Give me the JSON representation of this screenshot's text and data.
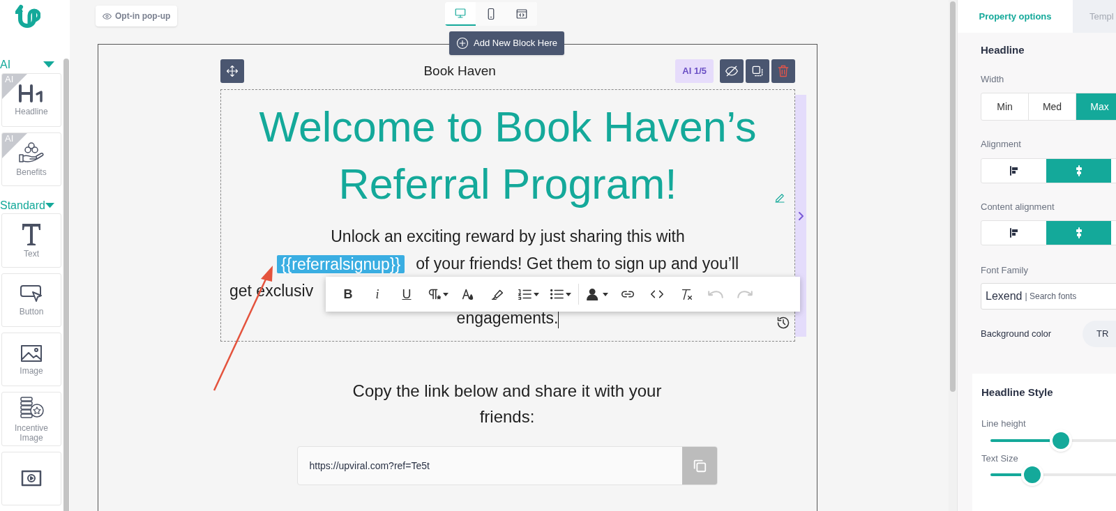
{
  "sidebar": {
    "sections": [
      {
        "title": "AI",
        "items": [
          {
            "label": "Headline",
            "kind": "h1",
            "badge": "AI"
          },
          {
            "label": "Benefits",
            "kind": "benefits",
            "badge": "AI"
          }
        ]
      },
      {
        "title": "Standard",
        "items": [
          {
            "label": "Text",
            "kind": "text"
          },
          {
            "label": "Button",
            "kind": "button"
          },
          {
            "label": "Image",
            "kind": "image"
          },
          {
            "label": "Incentive Image",
            "kind": "incentive"
          },
          {
            "kind": "video"
          }
        ]
      }
    ]
  },
  "topbar": {
    "preview_button": "Opt-in pop-up",
    "devices": [
      {
        "kind": "desktop",
        "selected": true
      },
      {
        "kind": "mobile",
        "selected": false
      },
      {
        "kind": "code",
        "selected": false
      }
    ],
    "add_block": "Add New Block Here"
  },
  "block": {
    "title": "Book Haven",
    "ai_counter": "AI 1/5",
    "headline": "Welcome to Book Haven’s Referral Program!",
    "paragraph_lines": [
      {
        "kind": "line",
        "parts": [
          {
            "kind": "text",
            "text": "Unlock an exciting reward by just sharing this with"
          }
        ]
      },
      {
        "kind": "line",
        "parts": [
          {
            "kind": "token",
            "text": "{{referralsignup}}"
          },
          {
            "kind": "text",
            "text": "of your friends! Get them to sign up and you’ll"
          }
        ]
      },
      {
        "kind": "covered",
        "parts": [
          {
            "kind": "text",
            "text": "get exclusiv"
          }
        ]
      },
      {
        "kind": "line",
        "parts": [
          {
            "kind": "text",
            "text": "engagements."
          }
        ],
        "cursor": true
      }
    ],
    "format_toolbar": [
      {
        "kind": "bold",
        "label": "B",
        "disabled": false
      },
      {
        "kind": "italic",
        "label": "i",
        "disabled": false
      },
      {
        "kind": "underline",
        "label": "U",
        "disabled": false
      },
      {
        "kind": "paragraph",
        "disabled": false
      },
      {
        "kind": "color",
        "disabled": false
      },
      {
        "kind": "highlight",
        "disabled": false
      },
      {
        "kind": "ordered",
        "disabled": false
      },
      {
        "kind": "bullets",
        "disabled": false
      },
      {
        "kind": "person",
        "disabled": false
      },
      {
        "kind": "link",
        "disabled": false
      },
      {
        "kind": "code",
        "disabled": false
      },
      {
        "kind": "clear",
        "disabled": false
      },
      {
        "kind": "undo",
        "disabled": true
      },
      {
        "kind": "redo",
        "disabled": true
      }
    ]
  },
  "share": {
    "text": "Copy the link below and share it with your friends:",
    "link": "https://upviral.com?ref=Te5t"
  },
  "panel": {
    "tabs": [
      {
        "label": "Property options",
        "selected": true
      },
      {
        "label": "Templ",
        "selected": false
      }
    ],
    "section": "Headline",
    "width": {
      "label": "Width",
      "options": [
        {
          "label": "Min",
          "selected": false
        },
        {
          "label": "Med",
          "selected": false
        },
        {
          "label": "Max",
          "selected": true
        }
      ]
    },
    "alignment": {
      "label": "Alignment",
      "options": [
        {
          "kind": "left",
          "selected": false
        },
        {
          "kind": "center",
          "selected": true
        }
      ]
    },
    "content_alignment": {
      "label": "Content alignment",
      "options": [
        {
          "kind": "left",
          "selected": false
        },
        {
          "kind": "center",
          "selected": true
        }
      ]
    },
    "font_family": {
      "label": "Font Family",
      "value": "Lexend",
      "placeholder": "| Search fonts"
    },
    "background": {
      "label": "Background color",
      "value": "TR"
    },
    "style": {
      "title": "Headline Style",
      "sliders": [
        {
          "label": "Line height",
          "level": 0.39
        },
        {
          "label": "Text Size",
          "level": 0.23
        }
      ]
    }
  }
}
